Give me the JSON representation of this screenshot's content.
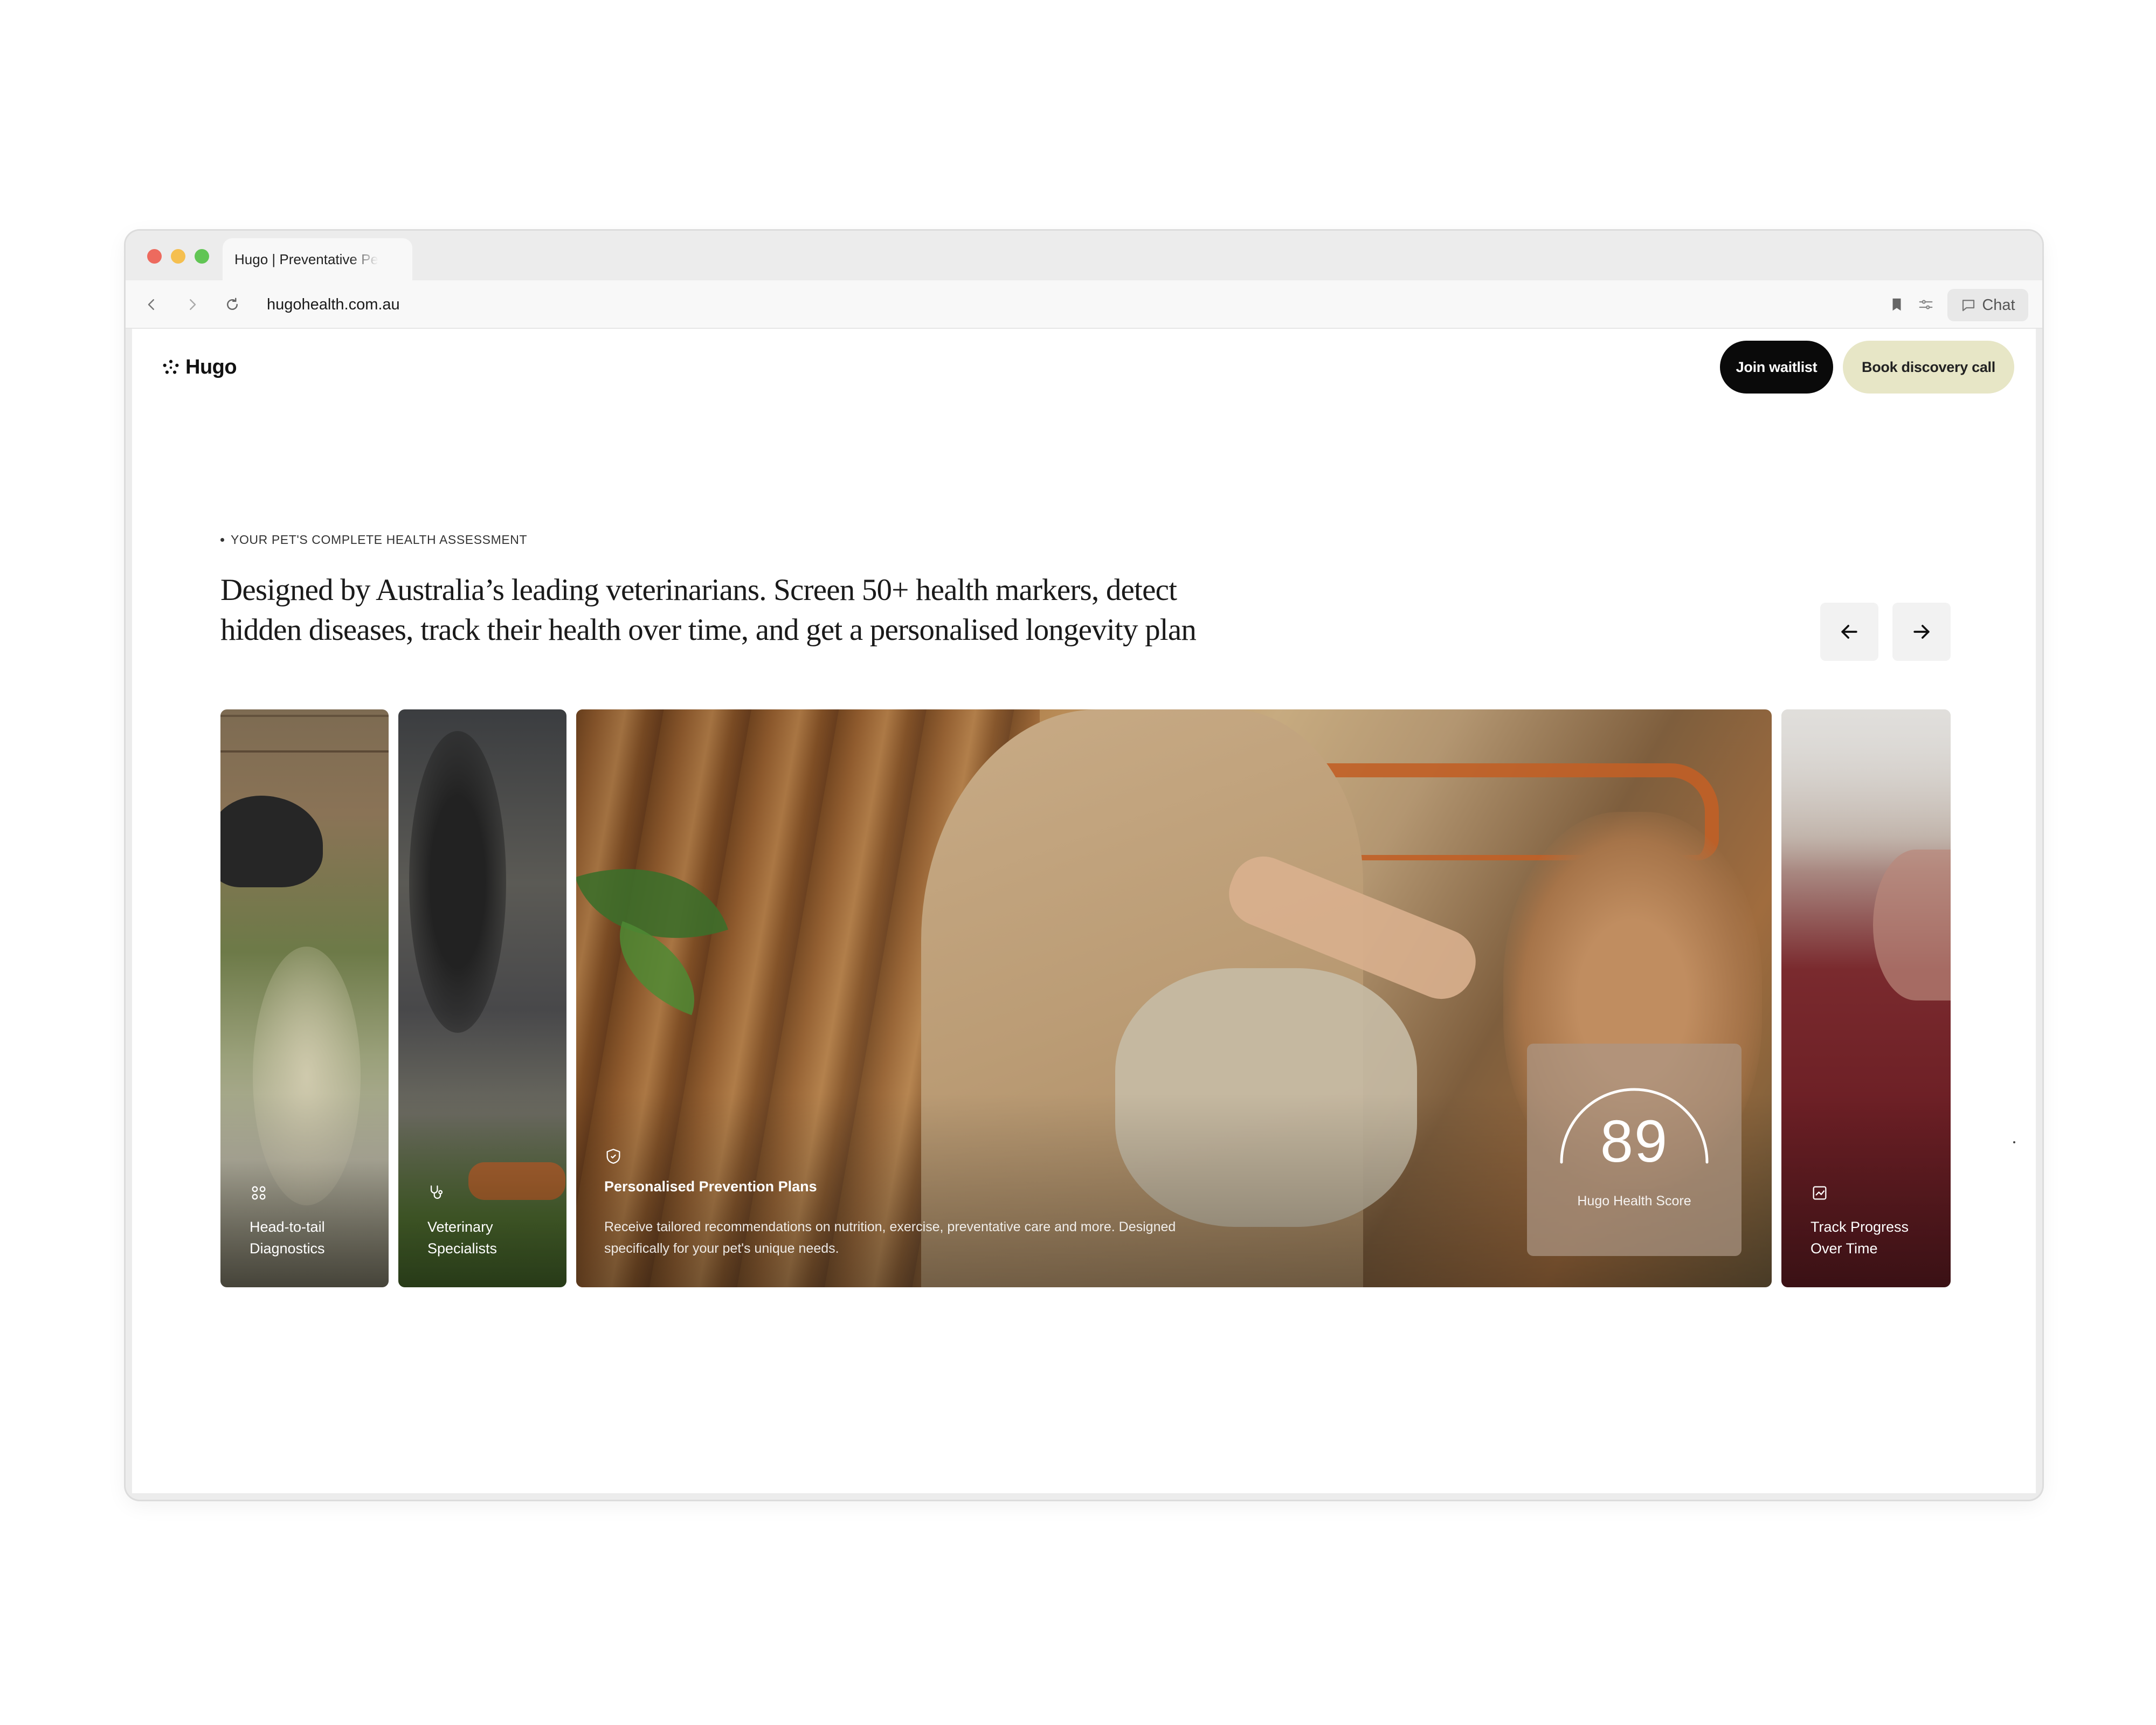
{
  "browser": {
    "tab_title": "Hugo | Preventative Pe",
    "url": "hugohealth.com.au",
    "chat_label": "Chat"
  },
  "site": {
    "logo_text": "Hugo",
    "buttons": {
      "join_waitlist": "Join waitlist",
      "book_call": "Book discovery call"
    }
  },
  "hero": {
    "eyebrow": "YOUR PET'S COMPLETE HEALTH ASSESSMENT",
    "headline_line1": "Designed by Australia’s leading veterinarians. Screen 50+ health markers, detect",
    "headline_line2": "hidden diseases, track their health over time, and get a personalised longevity plan"
  },
  "cards": [
    {
      "label_line1": "Head-to-tail",
      "label_line2": "Diagnostics",
      "icon": "grid-icon"
    },
    {
      "label_line1": "Veterinary",
      "label_line2": "Specialists",
      "icon": "stethoscope-icon"
    },
    {
      "title": "Personalised Prevention Plans",
      "description_line1": "Receive tailored recommendations on nutrition, exercise, preventative care and more. Designed",
      "description_line2": "specifically for your pet's unique needs.",
      "icon": "shield-icon"
    },
    {
      "label_line1": "Track Progress",
      "label_line2": "Over Time",
      "icon": "chart-icon"
    }
  ],
  "score": {
    "value": "89",
    "label": "Hugo Health Score"
  },
  "colors": {
    "waitlist_bg": "#0a0a0a",
    "discovery_bg": "#e7e6c6",
    "traffic_red": "#ed6a5e",
    "traffic_yellow": "#f5bf4f",
    "traffic_green": "#61c554"
  }
}
